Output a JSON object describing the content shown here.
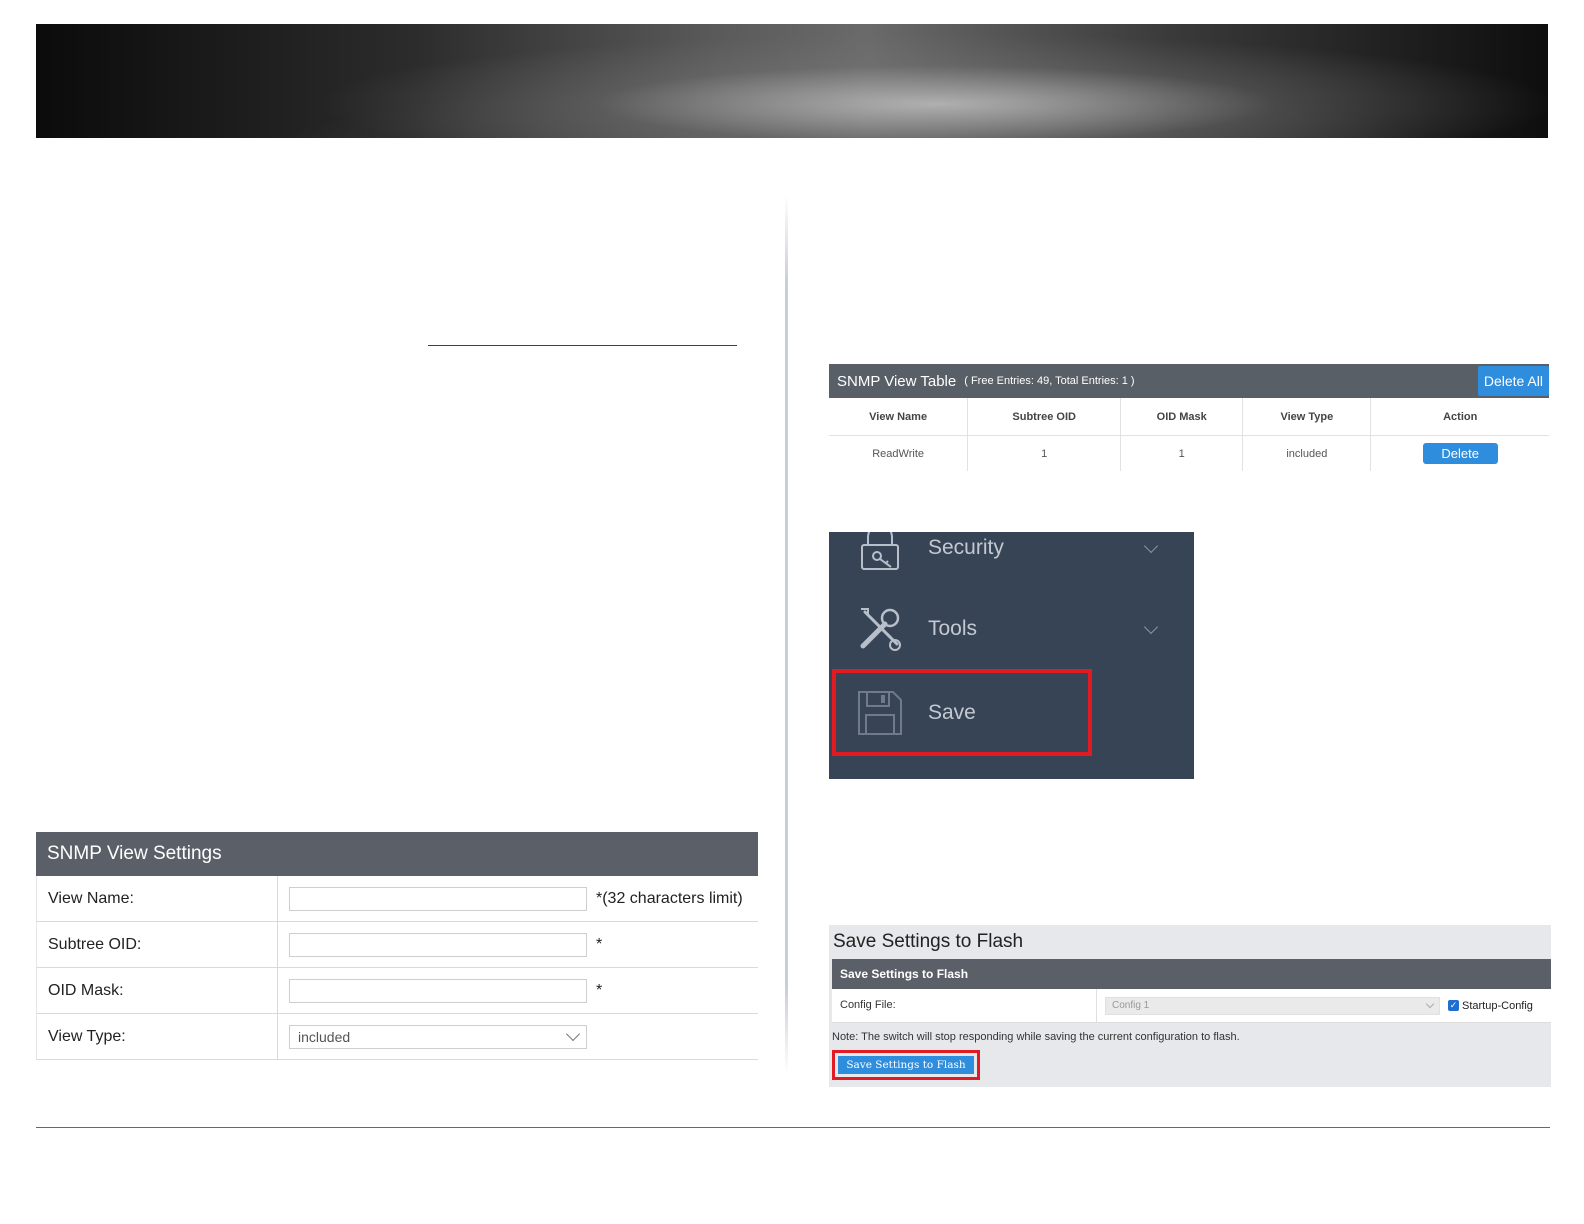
{
  "view_settings": {
    "title": "SNMP View Settings",
    "rows": [
      {
        "label": "View Name:",
        "note": "*(32 characters limit)"
      },
      {
        "label": "Subtree OID:",
        "note": "*"
      },
      {
        "label": "OID Mask:",
        "note": "*"
      },
      {
        "label": "View Type:",
        "select_value": "included"
      }
    ]
  },
  "view_table": {
    "title": "SNMP View Table",
    "subtitle": "( Free Entries: 49, Total Entries: 1 )",
    "delete_all_label": "Delete All",
    "columns": [
      "View Name",
      "Subtree OID",
      "OID Mask",
      "View Type",
      "Action"
    ],
    "rows": [
      {
        "view_name": "ReadWrite",
        "subtree_oid": "1",
        "oid_mask": "1",
        "view_type": "included",
        "action_label": "Delete"
      }
    ]
  },
  "menu": {
    "items": [
      {
        "label": "Security",
        "icon": "lock-icon"
      },
      {
        "label": "Tools",
        "icon": "tools-icon"
      },
      {
        "label": "Save",
        "icon": "floppy-disk-icon"
      }
    ],
    "highlight_color": "#e01b24"
  },
  "save_flash": {
    "title": "Save Settings to Flash",
    "bar_title": "Save Settings to Flash",
    "config_label": "Config File:",
    "config_value": "Config 1",
    "checkbox_label": "Startup-Config",
    "checkbox_checked": true,
    "note": "Note: The switch will stop responding while saving the current configuration to flash.",
    "button_label": "Save Settings to Flash"
  },
  "colors": {
    "accent_blue": "#2e8ddc",
    "header_gray": "#5b6068",
    "menu_bg": "#364456",
    "highlight_red": "#e01b24",
    "footer_rule": "#3b6fb6"
  }
}
